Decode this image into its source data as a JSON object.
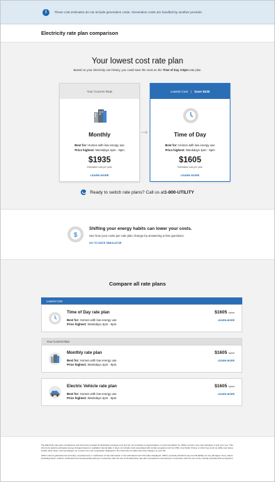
{
  "banner": {
    "text": "These cost estimates do not include generation costs. Generation costs are handled by another provider."
  },
  "header": {
    "title": "Electricity rate plan comparison"
  },
  "hero": {
    "title": "Your lowest cost rate plan",
    "subtitle_prefix": "Based on your electricity use history, you could save the most on the ",
    "subtitle_bold": "Time of Day 3-8pm",
    "subtitle_suffix": " rate plan."
  },
  "current_card": {
    "header": "Your Current Rate",
    "name": "Monthly",
    "best_label": "Best for:",
    "best_value": "Homes with low energy use",
    "price_label": "Price highest:",
    "price_value": "Weekdays 4pm - 9pm",
    "cost": "$1935",
    "cost_label": "Estimated cost per year",
    "learn": "LEARN MORE"
  },
  "lowest_card": {
    "header": "Lowest Cost",
    "separator": "|",
    "save": "Save $330",
    "name": "Time of Day",
    "best_label": "Best for:",
    "best_value": "Homes with low energy use",
    "price_label": "Price highest:",
    "price_value": "Weekdays 4pm - 9pm",
    "cost": "$1605",
    "cost_label": "Estimated cost per year",
    "learn": "LEARN MORE"
  },
  "call": {
    "prefix": "Ready to switch rate plans? Call us at ",
    "number": "1-800-UTILITY"
  },
  "shift": {
    "title": "Shifting your energy habits can lower your costs.",
    "subtitle": "See how your costs per rate plan change by answering a few questions.",
    "link": "GO TO RATE SIMULATOR"
  },
  "compare": {
    "title": "Compare all rate plans",
    "lowest_label": "Lowest Cost",
    "current_label": "Your Current Rate",
    "rows": [
      {
        "name": "Time of Day rate plan",
        "best_label": "Best for:",
        "best_value": "Homes with low energy use",
        "price_label": "Price highest:",
        "price_value": "Weekdays 4pm - 9pm",
        "cost": "$1605",
        "unit": "/year",
        "learn": "LEARN MORE"
      },
      {
        "name": "Monthly rate plan",
        "best_label": "Best for:",
        "best_value": "Homes with low energy use",
        "price_label": "Price highest:",
        "price_value": "Weekdays 4pm - 9pm",
        "cost": "$1605",
        "unit": "/year",
        "learn": "LEARN MORE"
      },
      {
        "name": "Electric Vehicle rate plan",
        "best_label": "Best for:",
        "best_value": "Homes with low energy use",
        "price_label": "Price highest:",
        "price_value": "Weekdays 4pm - 9pm",
        "cost": "$1605",
        "unit": "/year",
        "learn": "LEARN MORE"
      }
    ]
  },
  "footer": {
    "p1": "The Electricity rate plan comparisons and chart are provided for illustrative purposes only and do not constitute a representation or recommendation by UMCo to lock in any rate schedule or limit your use. This chart only depicts estimated energy charges based on available interval data. It does not include costs associated with certain programs such as CBA, Cool Solar Choice or other fees such as utility user taxes, certain other taxes, and surcharges. As a result, the cost comparison displayed in the chart will not reflect all of the charges on your bill.",
    "p2": "UMCo cannot guarantee the accuracy, completeness or usefulness of rate information or the estimated cost information displayed. UMCo expressly disclaims any and all liability for any damages of any nature (including direct, indirect, incidental and consequential) arising in connection with the use of the Electricity rate plan comparisons and arising in connection with the use of the monthly estimated bill comparison."
  },
  "colors": {
    "accent": "#2a6eb6",
    "link": "#1c67ae",
    "band": "#f2f2f2"
  }
}
